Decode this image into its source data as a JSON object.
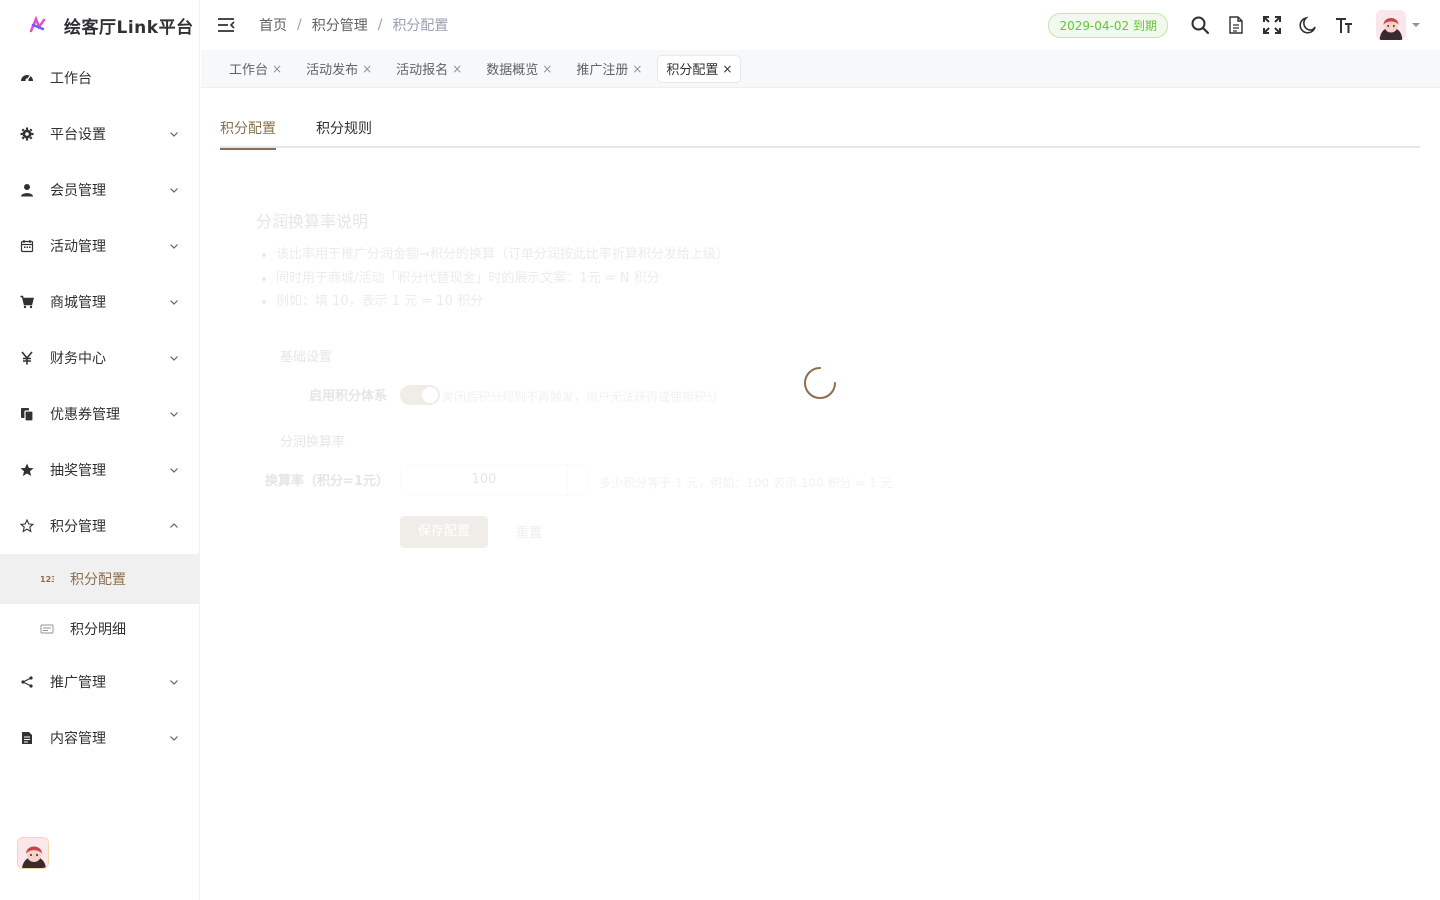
{
  "app": {
    "title": "绘客厅Link平台"
  },
  "sidebar": {
    "items": [
      {
        "label": "工作台",
        "icon": "dashboard-icon",
        "has_children": false
      },
      {
        "label": "平台设置",
        "icon": "gear-icon",
        "has_children": true
      },
      {
        "label": "会员管理",
        "icon": "user-icon",
        "has_children": true
      },
      {
        "label": "活动管理",
        "icon": "calendar-icon",
        "has_children": true
      },
      {
        "label": "商城管理",
        "icon": "cart-icon",
        "has_children": true
      },
      {
        "label": "财务中心",
        "icon": "yen-icon",
        "has_children": true
      },
      {
        "label": "优惠券管理",
        "icon": "coupon-icon",
        "has_children": true
      },
      {
        "label": "抽奖管理",
        "icon": "star-icon",
        "has_children": true
      },
      {
        "label": "积分管理",
        "icon": "star-outline-icon",
        "has_children": true,
        "expanded": true,
        "children": [
          {
            "label": "积分配置",
            "icon": "123-icon",
            "active": true
          },
          {
            "label": "积分明细",
            "icon": "list-icon",
            "active": false
          }
        ]
      },
      {
        "label": "推广管理",
        "icon": "share-icon",
        "has_children": true
      },
      {
        "label": "内容管理",
        "icon": "document-icon",
        "has_children": true
      }
    ]
  },
  "header": {
    "breadcrumb": [
      "首页",
      "积分管理",
      "积分配置"
    ],
    "expire_badge": "2029-04-02 到期",
    "accent_color": "#8b6f4e",
    "badge_color": "#67c23a"
  },
  "tags": [
    {
      "label": "工作台",
      "active": false
    },
    {
      "label": "活动发布",
      "active": false
    },
    {
      "label": "活动报名",
      "active": false
    },
    {
      "label": "数据概览",
      "active": false
    },
    {
      "label": "推广注册",
      "active": false
    },
    {
      "label": "积分配置",
      "active": true
    }
  ],
  "tags_close": "×",
  "tabs": [
    "积分配置",
    "积分规则"
  ],
  "content": {
    "info_title": "分润换算率说明",
    "info_points": [
      "该比率用于推广分润金额→积分的换算（订单分润按此比率折算积分发给上级）",
      "同时用于商城/活动「积分代替现金」时的展示文案：1元 = N 积分",
      "例如：填 10，表示 1 元 = 10 积分"
    ],
    "section_basic": "基础设置",
    "label_enable": "启用积分体系",
    "enable_tip": "关闭后积分规则不再触发，用户无法获得或使用积分",
    "section_rate": "分润换算率",
    "label_rate": "换算率（积分=1元）",
    "rate_value": "100",
    "rate_tip": "多少积分等于 1 元，例如：100 表示 100 积分 = 1 元",
    "save_button": "保存配置",
    "reset_button": "重置"
  }
}
